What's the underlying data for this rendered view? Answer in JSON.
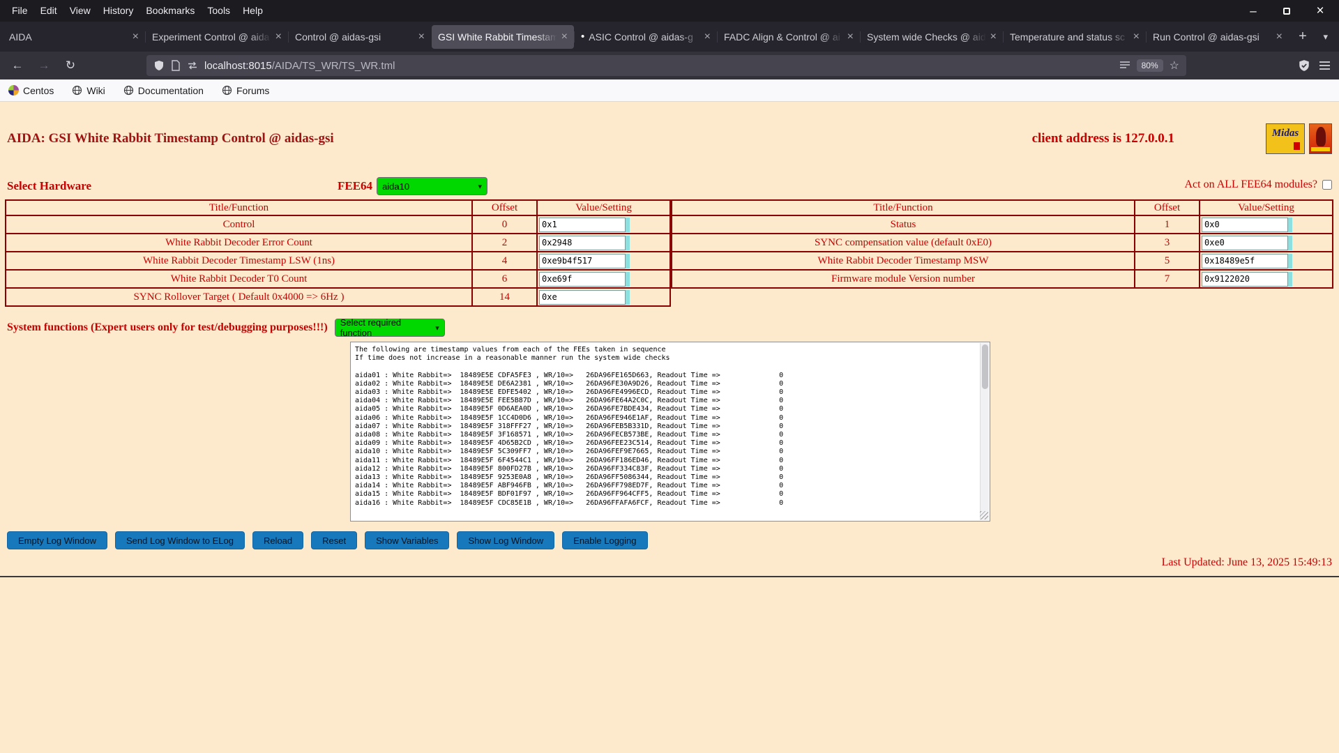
{
  "browser": {
    "menubar": [
      "File",
      "Edit",
      "View",
      "History",
      "Bookmarks",
      "Tools",
      "Help"
    ],
    "tabs": [
      {
        "label": "AIDA"
      },
      {
        "label": "Experiment Control @ aida"
      },
      {
        "label": "Control @ aidas-gsi"
      },
      {
        "label": "GSI White Rabbit Timestam"
      },
      {
        "label": "ASIC Control @ aidas-g"
      },
      {
        "label": "FADC Align & Control @ ai"
      },
      {
        "label": "System wide Checks @ aid"
      },
      {
        "label": "Temperature and status sc"
      },
      {
        "label": "Run Control @ aidas-gsi"
      }
    ],
    "url_host": "localhost:8015",
    "url_path": "/AIDA/TS_WR/TS_WR.tml",
    "zoom": "80%",
    "bookmarks": [
      "Centos",
      "Wiki",
      "Documentation",
      "Forums"
    ],
    "icons": {
      "close": "×",
      "back": "←",
      "forward": "→",
      "reload": "↻",
      "star": "☆",
      "new_tab": "+",
      "overflow": "▾",
      "dropdown": "▾",
      "attention_dot": "•",
      "minimize": "–"
    }
  },
  "page": {
    "header": {
      "title": "AIDA: GSI White Rabbit Timestamp Control @ aidas-gsi",
      "client_address": "client address is 127.0.0.1",
      "midas_logo_text": "Midas"
    },
    "hardware": {
      "select_label": "Select Hardware",
      "fee_label": "FEE64",
      "fee_value": "aida10",
      "act_all_label": "Act on ALL FEE64 modules?"
    },
    "registers": {
      "col_headers": [
        "Title/Function",
        "Offset",
        "Value/Setting"
      ],
      "left": [
        {
          "title": "Control",
          "offset": "0",
          "value": "0x1"
        },
        {
          "title": "White Rabbit Decoder Error Count",
          "offset": "2",
          "value": "0x2948"
        },
        {
          "title": "White Rabbit Decoder Timestamp LSW (1ns)",
          "offset": "4",
          "value": "0xe9b4f517"
        },
        {
          "title": "White Rabbit Decoder T0 Count",
          "offset": "6",
          "value": "0xe69f"
        },
        {
          "title": "SYNC Rollover Target ( Default 0x4000 => 6Hz )",
          "offset": "14",
          "value": "0xe"
        }
      ],
      "right": [
        {
          "title": "Status",
          "offset": "1",
          "value": "0x0"
        },
        {
          "title": "SYNC compensation value (default 0xE0)",
          "offset": "3",
          "value": "0xe0"
        },
        {
          "title": "White Rabbit Decoder Timestamp MSW",
          "offset": "5",
          "value": "0x18489e5f"
        },
        {
          "title": "Firmware module Version number",
          "offset": "7",
          "value": "0x9122020"
        }
      ]
    },
    "system_functions": {
      "label": "System functions (Expert users only for test/debugging purposes!!!)",
      "select_value": "Select required function"
    },
    "log_lines": [
      "The following are timestamp values from each of the FEEs taken in sequence",
      "If time does not increase in a reasonable manner run the system wide checks",
      "",
      "aida01 : White Rabbit=>  18489E5E CDFA5FE3 , WR/10=>   26DA96FE165D663, Readout Time =>              0",
      "aida02 : White Rabbit=>  18489E5E DE6A2381 , WR/10=>   26DA96FE30A9D26, Readout Time =>              0",
      "aida03 : White Rabbit=>  18489E5E EDFE5402 , WR/10=>   26DA96FE4996ECD, Readout Time =>              0",
      "aida04 : White Rabbit=>  18489E5E FEE5B87D , WR/10=>   26DA96FE64A2C0C, Readout Time =>              0",
      "aida05 : White Rabbit=>  18489E5F 0D6AEA0D , WR/10=>   26DA96FE7BDE434, Readout Time =>              0",
      "aida06 : White Rabbit=>  18489E5F 1CC4D0D6 , WR/10=>   26DA96FE946E1AF, Readout Time =>              0",
      "aida07 : White Rabbit=>  18489E5F 318FFF27 , WR/10=>   26DA96FEB5B331D, Readout Time =>              0",
      "aida08 : White Rabbit=>  18489E5F 3F168571 , WR/10=>   26DA96FECB573BE, Readout Time =>              0",
      "aida09 : White Rabbit=>  18489E5F 4D65B2CD , WR/10=>   26DA96FEE23C514, Readout Time =>              0",
      "aida10 : White Rabbit=>  18489E5F 5C309FF7 , WR/10=>   26DA96FEF9E7665, Readout Time =>              0",
      "aida11 : White Rabbit=>  18489E5F 6F4544C1 , WR/10=>   26DA96FF186ED46, Readout Time =>              0",
      "aida12 : White Rabbit=>  18489E5F 800FD27B , WR/10=>   26DA96FF334C83F, Readout Time =>              0",
      "aida13 : White Rabbit=>  18489E5F 9253E0A8 , WR/10=>   26DA96FF5086344, Readout Time =>              0",
      "aida14 : White Rabbit=>  18489E5F ABF946FB , WR/10=>   26DA96FF798ED7F, Readout Time =>              0",
      "aida15 : White Rabbit=>  18489E5F BDF01F97 , WR/10=>   26DA96FF964CFF5, Readout Time =>              0",
      "aida16 : White Rabbit=>  18489E5F CDC85E1B , WR/10=>   26DA96FFAFA6FCF, Readout Time =>              0"
    ],
    "buttons": [
      "Empty Log Window",
      "Send Log Window to ELog",
      "Reload",
      "Reset",
      "Show Variables",
      "Show Log Window",
      "Enable Logging"
    ],
    "footer": {
      "last_updated": "Last Updated: June 13, 2025 15:49:13"
    }
  }
}
